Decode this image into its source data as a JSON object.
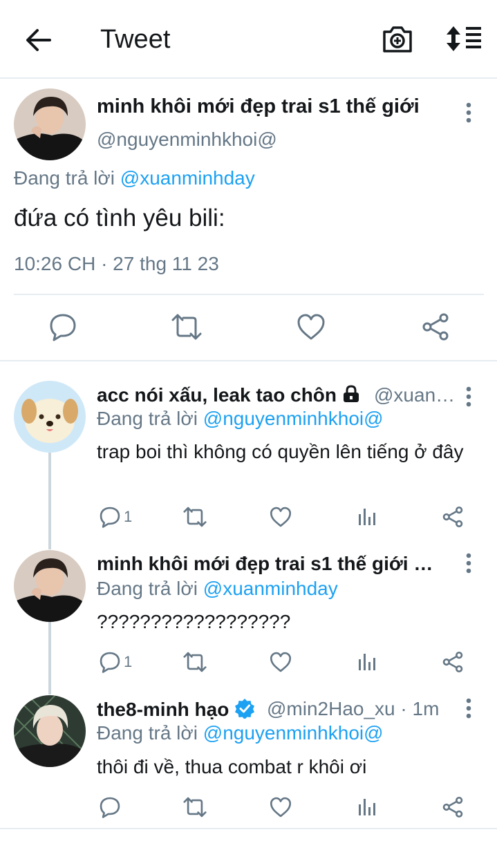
{
  "header": {
    "title": "Tweet",
    "icons": [
      "back-arrow-icon",
      "camera-add-icon",
      "sort-icon"
    ]
  },
  "main_tweet": {
    "display_name": "minh khôi mới đẹp trai s1 thế giới",
    "handle": "@nguyenminhkhoi@",
    "replying_prefix": "Đang trả lời",
    "replying_to": "@xuanminhday",
    "text": "đứa có tình yêu bili:",
    "timestamp": "10:26 CH · 27 thg 11 23"
  },
  "replies": [
    {
      "display_name": "acc nói xấu, leak tao chôn",
      "locked": true,
      "handle": "@xuan…",
      "replying_prefix": "Đang trả lời",
      "replying_to": "@nguyenminhkhoi@",
      "text": "trap boi thì không có quyền lên tiếng ở đây",
      "reply_count": "1"
    },
    {
      "display_name": "minh khôi mới đẹp trai s1 thế giới …",
      "replying_prefix": "Đang trả lời",
      "replying_to": "@xuanminhday",
      "text": "??????????????????",
      "reply_count": "1"
    },
    {
      "display_name": "the8-minh hạo",
      "verified": true,
      "handle": "@min2Hao_xu · 1m",
      "replying_prefix": "Đang trả lời",
      "replying_to": "@nguyenminhkhoi@",
      "text": "thôi đi về, thua combat r khôi ơi",
      "reply_count": ""
    }
  ],
  "colors": {
    "accent": "#1da1f2",
    "secondary_text": "#657786",
    "divider": "#e6ecf0"
  }
}
